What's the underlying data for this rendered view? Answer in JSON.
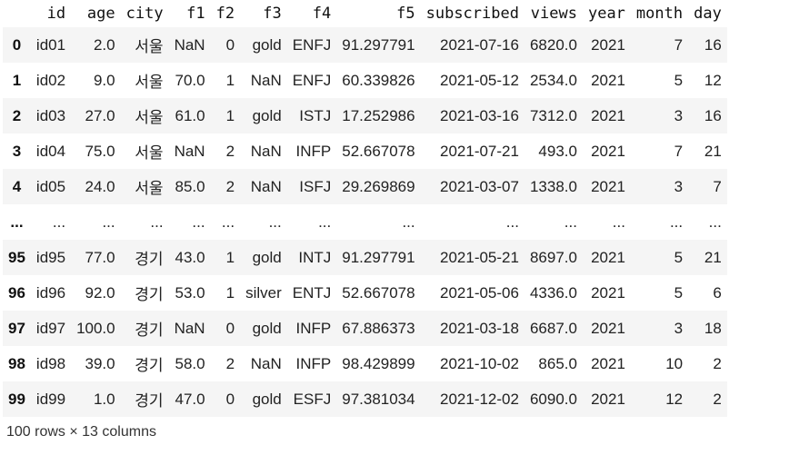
{
  "table": {
    "columns": [
      "",
      "id",
      "age",
      "city",
      "f1",
      "f2",
      "f3",
      "f4",
      "f5",
      "subscribed",
      "views",
      "year",
      "month",
      "day"
    ],
    "rows": [
      [
        "0",
        "id01",
        "2.0",
        "서울",
        "NaN",
        "0",
        "gold",
        "ENFJ",
        "91.297791",
        "2021-07-16",
        "6820.0",
        "2021",
        "7",
        "16"
      ],
      [
        "1",
        "id02",
        "9.0",
        "서울",
        "70.0",
        "1",
        "NaN",
        "ENFJ",
        "60.339826",
        "2021-05-12",
        "2534.0",
        "2021",
        "5",
        "12"
      ],
      [
        "2",
        "id03",
        "27.0",
        "서울",
        "61.0",
        "1",
        "gold",
        "ISTJ",
        "17.252986",
        "2021-03-16",
        "7312.0",
        "2021",
        "3",
        "16"
      ],
      [
        "3",
        "id04",
        "75.0",
        "서울",
        "NaN",
        "2",
        "NaN",
        "INFP",
        "52.667078",
        "2021-07-21",
        "493.0",
        "2021",
        "7",
        "21"
      ],
      [
        "4",
        "id05",
        "24.0",
        "서울",
        "85.0",
        "2",
        "NaN",
        "ISFJ",
        "29.269869",
        "2021-03-07",
        "1338.0",
        "2021",
        "3",
        "7"
      ],
      [
        "...",
        "...",
        "...",
        "...",
        "...",
        "...",
        "...",
        "...",
        "...",
        "...",
        "...",
        "...",
        "...",
        "..."
      ],
      [
        "95",
        "id95",
        "77.0",
        "경기",
        "43.0",
        "1",
        "gold",
        "INTJ",
        "91.297791",
        "2021-05-21",
        "8697.0",
        "2021",
        "5",
        "21"
      ],
      [
        "96",
        "id96",
        "92.0",
        "경기",
        "53.0",
        "1",
        "silver",
        "ENTJ",
        "52.667078",
        "2021-05-06",
        "4336.0",
        "2021",
        "5",
        "6"
      ],
      [
        "97",
        "id97",
        "100.0",
        "경기",
        "NaN",
        "0",
        "gold",
        "INFP",
        "67.886373",
        "2021-03-18",
        "6687.0",
        "2021",
        "3",
        "18"
      ],
      [
        "98",
        "id98",
        "39.0",
        "경기",
        "58.0",
        "2",
        "NaN",
        "INFP",
        "98.429899",
        "2021-10-02",
        "865.0",
        "2021",
        "10",
        "2"
      ],
      [
        "99",
        "id99",
        "1.0",
        "경기",
        "47.0",
        "0",
        "gold",
        "ESFJ",
        "97.381034",
        "2021-12-02",
        "6090.0",
        "2021",
        "12",
        "2"
      ]
    ]
  },
  "footer": "100 rows × 13 columns"
}
